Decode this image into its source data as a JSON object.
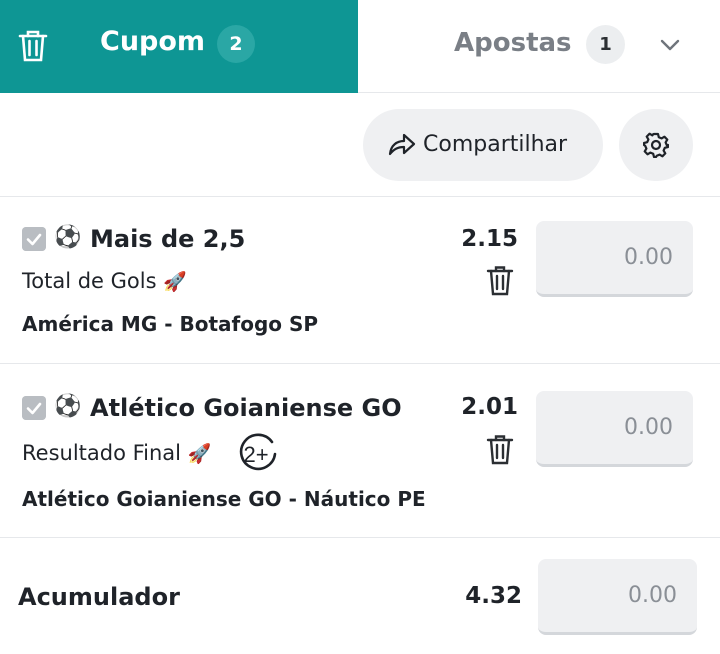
{
  "tabs": {
    "cupom": {
      "label": "Cupom",
      "count": "2"
    },
    "apostas": {
      "label": "Apostas",
      "count": "1"
    }
  },
  "toolbar": {
    "share_label": "Compartilhar"
  },
  "bets": [
    {
      "selection": "Mais de 2,5",
      "market": "Total de Gols",
      "match_home": "América MG",
      "match_away": "Botafogo SP",
      "odd": "2.15",
      "stake_placeholder": "0.00"
    },
    {
      "selection": "Atlético Goianiense GO",
      "market": "Resultado Final",
      "match_home": "Atlético Goianiense GO",
      "match_away": "Náutico PE",
      "odd": "2.01",
      "stake_placeholder": "0.00",
      "boost_badge": "2+"
    }
  ],
  "accumulator": {
    "label": "Acumulador",
    "odd": "4.32",
    "stake_placeholder": "0.00"
  },
  "colors": {
    "accent": "#0e9694",
    "badge_teal": "#2aa7a5",
    "surface": "#eff0f2"
  },
  "icons": [
    "trash-icon",
    "chevron-down-icon",
    "share-icon",
    "gear-icon",
    "checkbox-icon",
    "soccer-ball-icon",
    "rocket-icon",
    "boost-2plus-icon"
  ]
}
